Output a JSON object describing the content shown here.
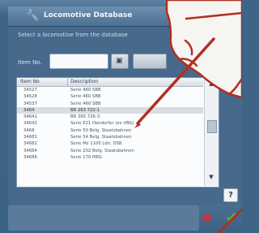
{
  "window": {
    "title": "Locomotive Database",
    "icon": "wrench-icon",
    "instruction": "Select a locomotive from the database"
  },
  "search": {
    "label": "Item No.",
    "value": "",
    "button_icon": "binoculars-icon"
  },
  "list": {
    "columns": [
      "Item No.",
      "Description"
    ],
    "rows": [
      {
        "no": "34527",
        "desc": "Serie 460 SBB"
      },
      {
        "no": "34528",
        "desc": "Serie 460 SBB"
      },
      {
        "no": "34537",
        "desc": "Serie 460 SBB"
      },
      {
        "no": "3464",
        "desc": "BR 263 722-1"
      },
      {
        "no": "34641",
        "desc": "BR 365 726-3"
      },
      {
        "no": "34642",
        "desc": "Serie E21 Handorfer (ex VBG)"
      },
      {
        "no": "3468",
        "desc": "Serie 50 Belg. Staatsbahnen"
      },
      {
        "no": "34681",
        "desc": "Serie 54 Belg. Staatsbahnen"
      },
      {
        "no": "34682",
        "desc": "Serie Mz 1100 Ldn. DSB"
      },
      {
        "no": "34684",
        "desc": "Serie 202 Belg. Staatsbahnen"
      },
      {
        "no": "34686",
        "desc": "Serie 170 MEG"
      }
    ],
    "selected_row": 3
  },
  "buttons": {
    "help": "?",
    "cancel_icon": "cross-icon",
    "ok_icon": "check-icon"
  },
  "colors": {
    "window": "#46698c",
    "title": "#f1f5fa",
    "cancel": "#d72d2d",
    "ok": "#5caa3b",
    "pen": "#b22e22"
  }
}
